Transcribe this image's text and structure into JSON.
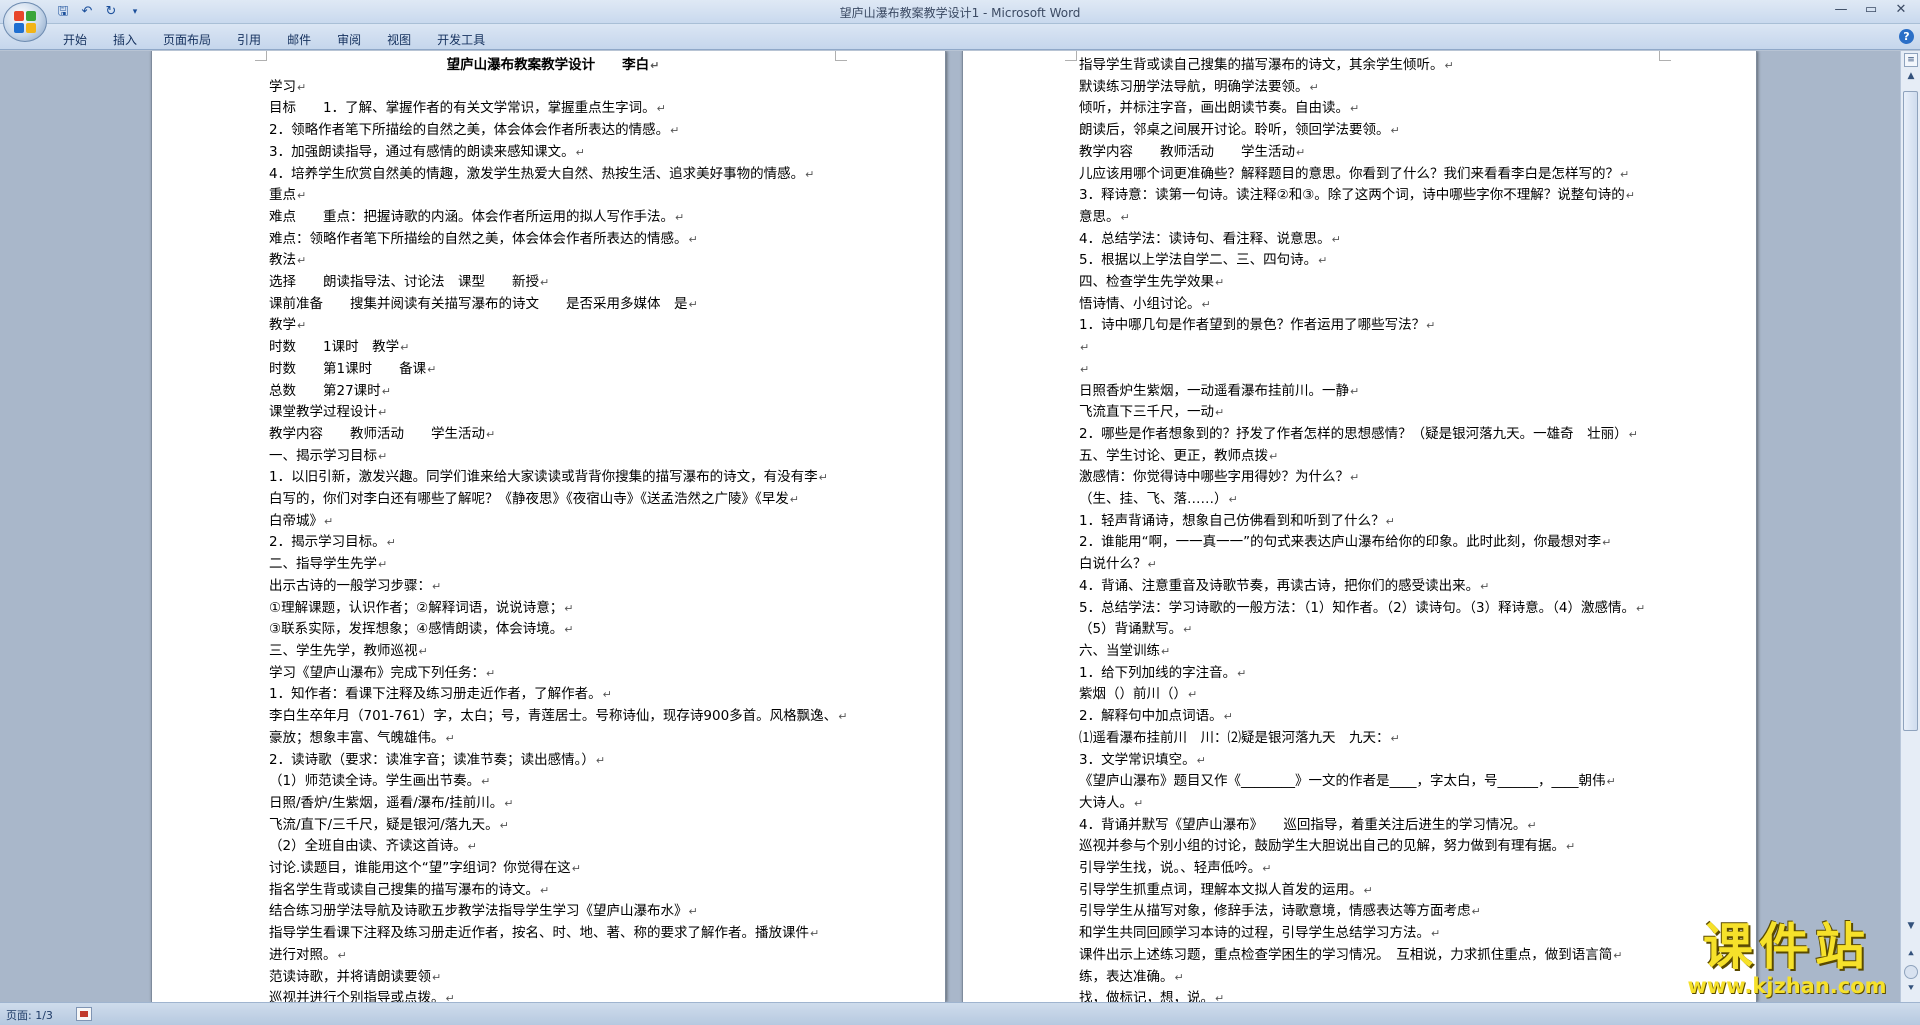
{
  "window": {
    "title": "望庐山瀑布教案教学设计1 - Microsoft Word",
    "controls": [
      "—",
      "▭",
      "✕"
    ]
  },
  "quick_access": {
    "save_icon": "save-icon",
    "undo_icon": "undo-icon",
    "redo_icon": "redo-icon",
    "customize_icon": "dropdown-icon"
  },
  "ribbon": {
    "tabs": [
      "开始",
      "插入",
      "页面布局",
      "引用",
      "邮件",
      "审阅",
      "视图",
      "开发工具"
    ],
    "help": "?"
  },
  "page1": {
    "title": "望庐山瀑布教案教学设计　　李白",
    "lines": [
      "学习",
      "目标　　1．了解、掌握作者的有关文学常识，掌握重点生字词。",
      "2．领略作者笔下所描绘的自然之美，体会体会作者所表达的情感。",
      "3．加强朗读指导，通过有感情的朗读来感知课文。",
      "4．培养学生欣赏自然美的情趣，激发学生热爱大自然、热按生活、追求美好事物的情感。",
      "重点",
      "难点　　重点：把握诗歌的内涵。体会作者所运用的拟人写作手法。",
      "难点：领略作者笔下所描绘的自然之美，体会体会作者所表达的情感。",
      "教法",
      "选择　　朗读指导法、讨论法　课型　　新授",
      "课前准备　　搜集并阅读有关描写瀑布的诗文　　是否采用多媒体　是",
      "教学",
      "时数　　1课时　教学",
      "时数　　第1课时　　备课",
      "总数　　第27课时",
      "课堂教学过程设计",
      "教学内容　　教师活动　　学生活动",
      "一、揭示学习目标",
      "1．以旧引新，激发兴趣。同学们谁来给大家读读或背背你搜集的描写瀑布的诗文，有没有李",
      "白写的，你们对李白还有哪些了解呢？《静夜思》《夜宿山寺》《送孟浩然之广陵》《早发",
      "白帝城》",
      "2．揭示学习目标。",
      "二、指导学生先学",
      "出示古诗的一般学习步骤：",
      "①理解课题，认识作者；②解释词语，说说诗意；",
      "③联系实际，发挥想象；④感情朗读，体会诗境。",
      "三、学生先学，教师巡视",
      "学习《望庐山瀑布》完成下列任务：",
      "1．知作者：看课下注释及练习册走近作者，了解作者。",
      "李白生卒年月（701-761）字，太白；号，青莲居士。号称诗仙，现存诗900多首。风格飘逸、",
      "豪放；想象丰富、气魄雄伟。",
      "2．读诗歌（要求：读准字音；读准节奏；读出感情。）",
      "（1）师范读全诗。学生画出节奏。",
      "日照/香炉/生紫烟，遥看/瀑布/挂前川。",
      "飞流/直下/三千尺，疑是银河/落九天。",
      "（2）全班自由读、齐读这首诗。",
      "讨论.读题目，谁能用这个“望”字组词？你觉得在这",
      "指名学生背或读自己搜集的描写瀑布的诗文。",
      "结合练习册学法导航及诗歌五步教学法指导学生学习《望庐山瀑布水》",
      "指导学生看课下注释及练习册走近作者，按名、时、地、著、称的要求了解作者。播放课件",
      "进行对照。",
      "范读诗歌，并将请朗读要领",
      "巡视并进行个别指导或点拨。"
    ]
  },
  "page2": {
    "lines": [
      "指导学生背或读自己搜集的描写瀑布的诗文，其余学生倾听。",
      "默读练习册学法导航，明确学法要领。",
      "倾听，并标注字音，画出朗读节奏。自由读。",
      "朗读后，邻桌之间展开讨论。聆听，领回学法要领。",
      "教学内容　　教师活动　　学生活动",
      "儿应该用哪个词更准确些？解释题目的意思。你看到了什么？我们来看看李白是怎样写的？",
      "3．释诗意：读第一句诗。读注释②和③。除了这两个词，诗中哪些字你不理解？说整句诗的",
      "意思。",
      "4．总结学法：读诗句、看注释、说意思。",
      "5．根据以上学法自学二、三、四句诗。",
      "四、检查学生先学效果",
      "悟诗情、小组讨论。",
      "1．诗中哪几句是作者望到的景色？作者运用了哪些写法？",
      "",
      "",
      "日照香炉生紫烟，一动遥看瀑布挂前川。一静",
      "飞流直下三千尺，一动",
      "2．哪些是作者想象到的？抒发了作者怎样的思想感情？（疑是银河落九天。一雄奇　壮丽）",
      "五、学生讨论、更正，教师点拨",
      "激感情：你觉得诗中哪些字用得妙？为什么？",
      "（生、挂、飞、落……）",
      "1．轻声背诵诗，想象自己仿佛看到和听到了什么？",
      "2．谁能用“啊，一一真一一”的句式来表达庐山瀑布给你的印象。此时此刻，你最想对李",
      "白说什么？",
      "4．背诵、注意重音及诗歌节奏，再读古诗，把你们的感受读出来。",
      "5．总结学法：学习诗歌的一般方法：（1）知作者。（2）读诗句。（3）释诗意。（4）激感情。",
      "（5）背诵默写。",
      "六、当堂训练",
      "1．给下列加线的字注音。",
      "紫烟（）前川（）",
      "2．解释句中加点词语。",
      "⑴遥看瀑布挂前川　川：⑵疑是银河落九天　九天：",
      "3．文学常识填空。",
      "《望庐山瀑布》题目又作《________》一文的作者是____，字太白，号______，____朝伟",
      "大诗人。",
      "4．背诵并默写《望庐山瀑布》　　巡回指导，着重关注后进生的学习情况。",
      "巡视并参与个别小组的讨论，鼓励学生大胆说出自己的见解，努力做到有理有据。",
      "引导学生找，说。、轻声低吟。",
      "引导学生抓重点词，理解本文拟人首发的运用。",
      "引导学生从描写对象，修辞手法，诗歌意境，情感表达等方面考虑",
      "和学生共同回顾学习本诗的过程，引导学生总结学习方法。",
      "课件出示上述练习题，重点检查学困生的学习情况。　互相说，力求抓住重点，做到语言简",
      "练，表达准确。",
      "找，做标记，想，说。"
    ]
  },
  "statusbar": {
    "page_count": "页面: 1/3"
  },
  "watermark": {
    "text": "课件站",
    "url": "www.kjzhan.com"
  },
  "colors": {
    "office_logo": [
      "#e8472b",
      "#3aa53a",
      "#1f6fd1",
      "#f2b417"
    ],
    "watermark": "#f6e12a"
  }
}
